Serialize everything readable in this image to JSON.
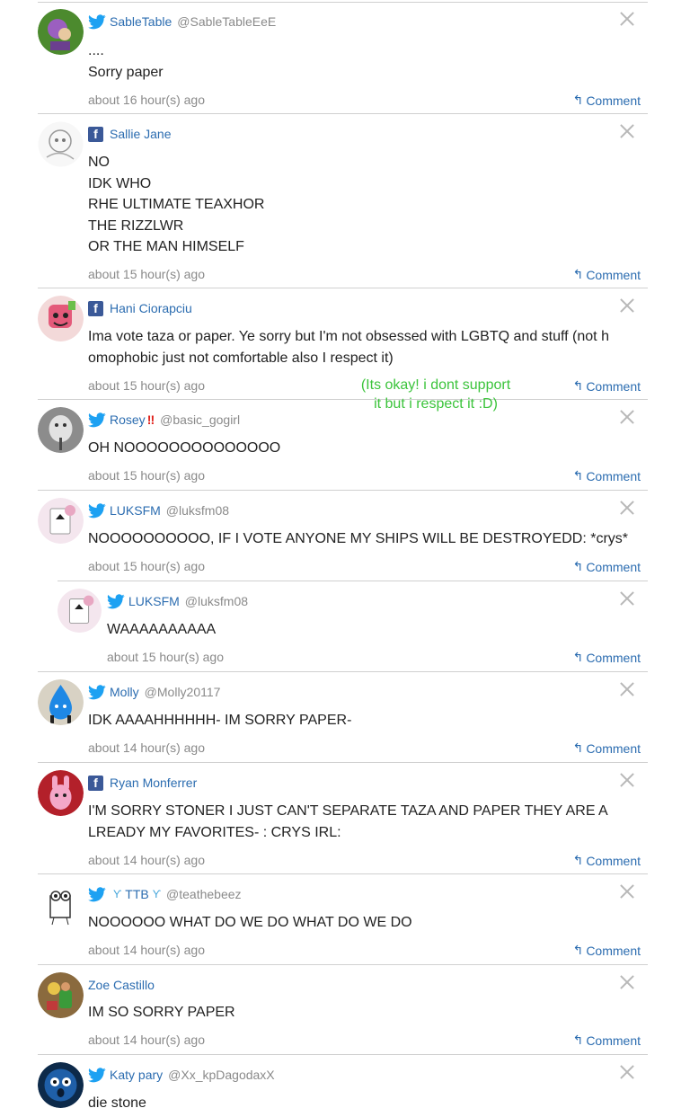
{
  "ui": {
    "comment_label": "Comment"
  },
  "comments": [
    {
      "author": "SableTable",
      "handle": "@SableTableEeE",
      "network": "twitter",
      "lines": "....\nSorry paper",
      "time": "about 16 hour(s) ago"
    },
    {
      "author": "Sallie Jane",
      "handle": "",
      "network": "facebook",
      "lines": "NO\nIDK WHO\nRHE ULTIMATE TEAXHOR\nTHE RIZZLWR\nOR THE MAN HIMSELF",
      "time": "about 15 hour(s) ago"
    },
    {
      "author": "Hani Ciorapciu",
      "handle": "",
      "network": "facebook",
      "lines": "Ima vote taza or paper. Ye sorry but I'm not obsessed with LGBTQ and stuff (not homophobic just not comfortable also I respect it)",
      "time": "about 15 hour(s) ago"
    },
    {
      "author": "Rosey",
      "author_decor": "‼",
      "handle": "@basic_gogirl",
      "network": "twitter",
      "lines": "OH NOOOOOOOOOOOOOO",
      "time": "about 15 hour(s) ago"
    },
    {
      "author": "LUKSFM",
      "handle": "@luksfm08",
      "network": "twitter",
      "lines": "NOOOOOOOOOO, IF I VOTE ANYONE MY SHIPS WILL BE DESTROYEDD: *crys*",
      "time": "about 15 hour(s) ago"
    },
    {
      "author": "LUKSFM",
      "handle": "@luksfm08",
      "network": "twitter",
      "lines": "WAAAAAAAAAA",
      "time": "about 15 hour(s) ago"
    },
    {
      "author": "Molly",
      "handle": "@Molly20117",
      "network": "twitter",
      "lines": "IDK AAAAHHHHHH- IM SORRY PAPER-",
      "time": "about 14 hour(s) ago"
    },
    {
      "author": "Ryan Monferrer",
      "handle": "",
      "network": "facebook",
      "lines": "I'M SORRY STONER I JUST CAN'T SEPARATE TAZA AND PAPER THEY ARE ALREADY MY FAVORITES- : CRYS IRL:",
      "time": "about 14 hour(s) ago"
    },
    {
      "author": "TTB",
      "handle": "@teathebeez",
      "network": "twitter",
      "lines": "NOOOOOO WHAT DO WE DO WHAT DO WE DO",
      "time": "about 14 hour(s) ago"
    },
    {
      "author": "Zoe Castillo",
      "handle": "",
      "network": "none",
      "lines": "IM SO SORRY PAPER",
      "time": "about 14 hour(s) ago"
    },
    {
      "author": "Katy pary",
      "handle": "@Xx_kpDagodaxX",
      "network": "twitter",
      "lines": "die stone",
      "time": ""
    }
  ],
  "annotation": {
    "text": "(Its okay! i dont support\nit but i respect it :D)",
    "color": "#3cc43c"
  },
  "colors": {
    "link": "#2b6cb0",
    "muted": "#8a8a8a",
    "facebook": "#3b5998",
    "twitter": "#1da1f2"
  }
}
